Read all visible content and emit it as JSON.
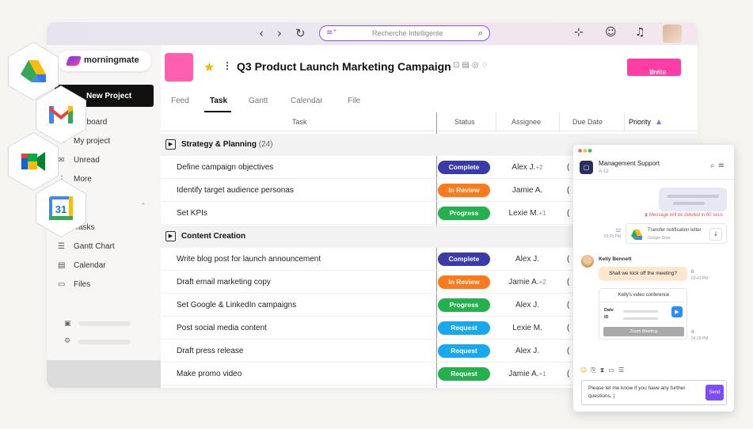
{
  "search": {
    "placeholder": "Recherche Intelligente"
  },
  "brand": {
    "name": "morningmate"
  },
  "sidebar": {
    "new_project": "New Project",
    "items": [
      {
        "label": "Dashboard",
        "visible": "shboard",
        "icon": "dashboard-icon"
      },
      {
        "label": "My project",
        "icon": "folder-icon"
      },
      {
        "label": "Unread",
        "icon": "mail-icon"
      },
      {
        "label": "More",
        "icon": "more-icon"
      }
    ],
    "views": [
      {
        "label": "Tasks",
        "icon": "tasks-icon"
      },
      {
        "label": "Gantt Chart",
        "icon": "gantt-icon"
      },
      {
        "label": "Calendar",
        "icon": "calendar-icon"
      },
      {
        "label": "Files",
        "icon": "files-icon"
      }
    ]
  },
  "project": {
    "title": "Q3 Product Launch Marketing Campaign",
    "invite": "Invite"
  },
  "tabs": [
    "Feed",
    "Task",
    "Gantt",
    "Calendar",
    "File"
  ],
  "active_tab": "Task",
  "columns": {
    "task": "Task",
    "status": "Status",
    "assignee": "Assignee",
    "due": "Due Date",
    "priority": "Priority"
  },
  "groups": [
    {
      "name": "Strategy & Planning",
      "count": "(24)",
      "tasks": [
        {
          "name": "Define campaign objectives",
          "status": "Complete",
          "color": "#3a3aa8",
          "assignee": "Alex J.",
          "extra": "+2"
        },
        {
          "name": "Identify target audience personas",
          "status": "In Review",
          "color": "#ff7a1a",
          "assignee": "Jamie A.",
          "extra": ""
        },
        {
          "name": "Set KPIs",
          "status": "Progress",
          "color": "#22b14c",
          "assignee": "Lexie M.",
          "extra": "+1"
        }
      ]
    },
    {
      "name": "Content Creation",
      "count": "",
      "tasks": [
        {
          "name": "Write blog post for launch announcement",
          "status": "Complete",
          "color": "#3a3aa8",
          "assignee": "Alex J.",
          "extra": ""
        },
        {
          "name": "Draft email marketing copy",
          "status": "In Review",
          "color": "#ff7a1a",
          "assignee": "Jamie A.",
          "extra": "+2"
        },
        {
          "name": "Set Google & LinkedIn campaigns",
          "status": "Progress",
          "color": "#22b14c",
          "assignee": "Alex J.",
          "extra": ""
        },
        {
          "name": "Post social media content",
          "status": "Request",
          "color": "#17a8f0",
          "assignee": "Lexie M.",
          "extra": ""
        },
        {
          "name": "Draft press release",
          "status": "Request",
          "color": "#17a8f0",
          "assignee": "Alex J.",
          "extra": ""
        },
        {
          "name": "Make promo video",
          "status": "Request",
          "color": "#22b14c",
          "assignee": "Jamie A.",
          "extra": "+1"
        }
      ]
    }
  ],
  "chat": {
    "title": "Management Support",
    "subtitle": "A-12",
    "delete_note": "Message will be deleted in 60 secs.",
    "file_name": "Transfer notification letter",
    "file_source": "Google Drive",
    "file_count": "12",
    "file_time": "03:25 PM",
    "sender": "Kelly Bennett",
    "message": "Shall we kick off the meeting?",
    "msg_count": "8",
    "msg_time": "03:41 PM",
    "video_title": "Kelly's video conference",
    "date_label": "Date",
    "id_label": "ID",
    "zoom_button": "Zoom Meeting",
    "video_count": "4",
    "video_time": "04:28 PM",
    "draft": "Please let me know if you have any further questions. |",
    "send": "Send"
  },
  "integrations": [
    "google-drive-icon",
    "gmail-icon",
    "google-meet-icon",
    "google-calendar-icon"
  ],
  "calendar_day": "31"
}
